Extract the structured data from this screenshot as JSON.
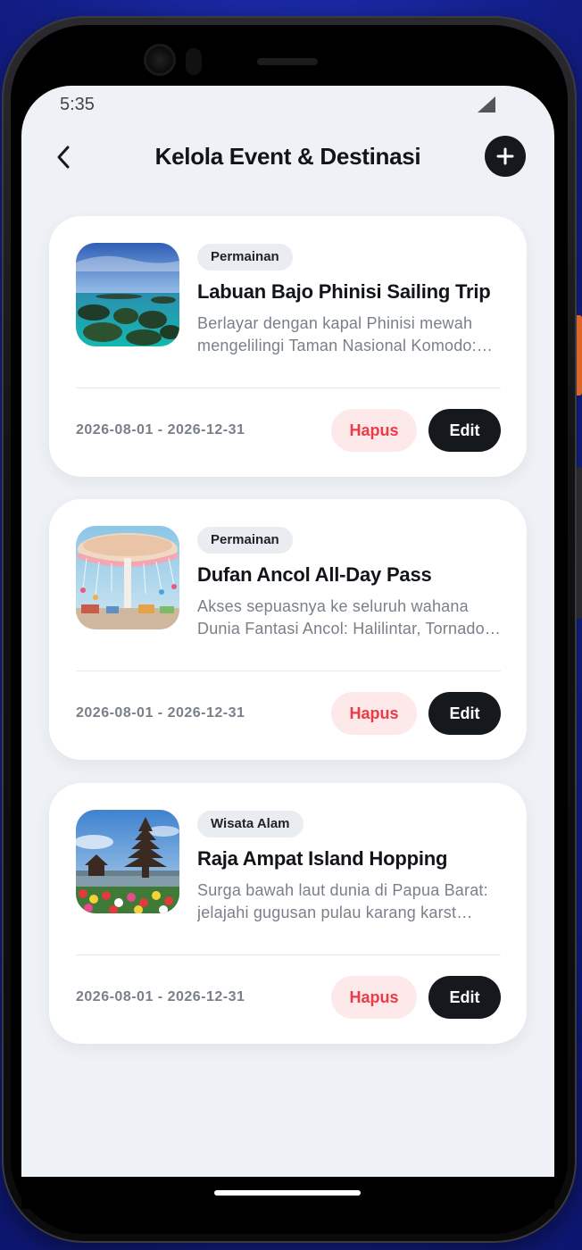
{
  "status_bar": {
    "time": "5:35",
    "signal_icon": "cellular-signal-icon"
  },
  "header": {
    "title": "Kelola Event & Destinasi",
    "back_icon": "chevron-left-icon",
    "add_icon": "plus-icon"
  },
  "events": [
    {
      "category": "Permainan",
      "title": "Labuan Bajo Phinisi Sailing Trip",
      "description": "Berlayar dengan kapal Phinisi mewah mengelilingi Taman Nasional Komodo: mengunjungi Pulau Padar",
      "date_range": "2026-08-01 - 2026-12-31",
      "delete_label": "Hapus",
      "edit_label": "Edit",
      "image": "islands-photo"
    },
    {
      "category": "Permainan",
      "title": "Dufan Ancol All-Day Pass",
      "description": "Akses sepuasnya ke seluruh wahana Dunia Fantasi Ancol: Halilintar, Tornado, Kora-Kora",
      "date_range": "2026-08-01 - 2026-12-31",
      "delete_label": "Hapus",
      "edit_label": "Edit",
      "image": "carousel-ride-photo"
    },
    {
      "category": "Wisata Alam",
      "title": "Raja Ampat Island Hopping",
      "description": "Surga bawah laut dunia di Papua Barat: jelajahi gugusan pulau karang karst Wayag",
      "date_range": "2026-08-01 - 2026-12-31",
      "delete_label": "Hapus",
      "edit_label": "Edit",
      "image": "temple-pagoda-photo"
    }
  ],
  "colors": {
    "background": "#eef1f5",
    "card": "#ffffff",
    "primary_dark": "#15181c",
    "danger": "#ee3a46",
    "danger_bg": "#fde9ea",
    "muted_text": "#7a8089",
    "tag_bg": "#e9ecf1"
  }
}
